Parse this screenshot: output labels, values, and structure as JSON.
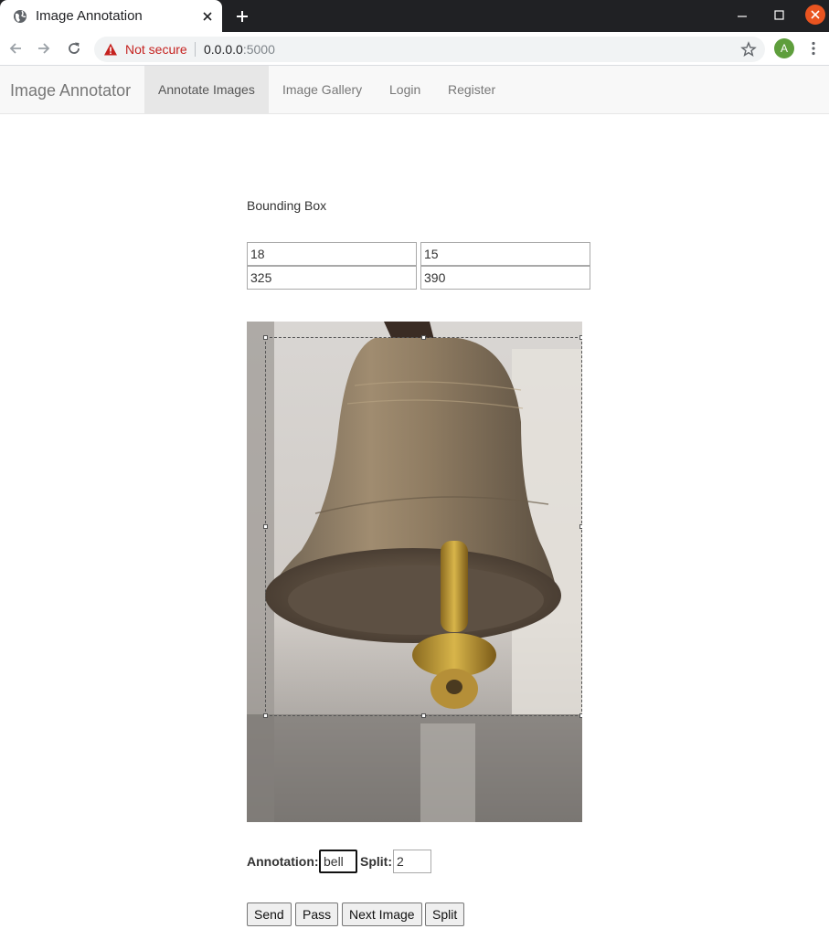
{
  "browser": {
    "tab_title": "Image Annotation",
    "security_label": "Not secure",
    "url_host": "0.0.0.0",
    "url_port": ":5000",
    "profile_initial": "A"
  },
  "navbar": {
    "brand": "Image Annotator",
    "items": [
      {
        "label": "Annotate Images",
        "active": true
      },
      {
        "label": "Image Gallery",
        "active": false
      },
      {
        "label": "Login",
        "active": false
      },
      {
        "label": "Register",
        "active": false
      }
    ]
  },
  "bounding_box": {
    "label": "Bounding Box",
    "x1": "18",
    "y1": "15",
    "x2": "325",
    "y2": "390"
  },
  "image": {
    "subject": "brass bell"
  },
  "form": {
    "annotation_label": "Annotation:",
    "annotation_value": "bell",
    "split_label": "Split:",
    "split_value": "2"
  },
  "buttons": {
    "send": "Send",
    "pass": "Pass",
    "next": "Next Image",
    "split": "Split"
  },
  "colors": {
    "accent_close": "#e95420",
    "navbar_bg": "#f8f8f8",
    "navbar_active": "#e7e7e7"
  }
}
